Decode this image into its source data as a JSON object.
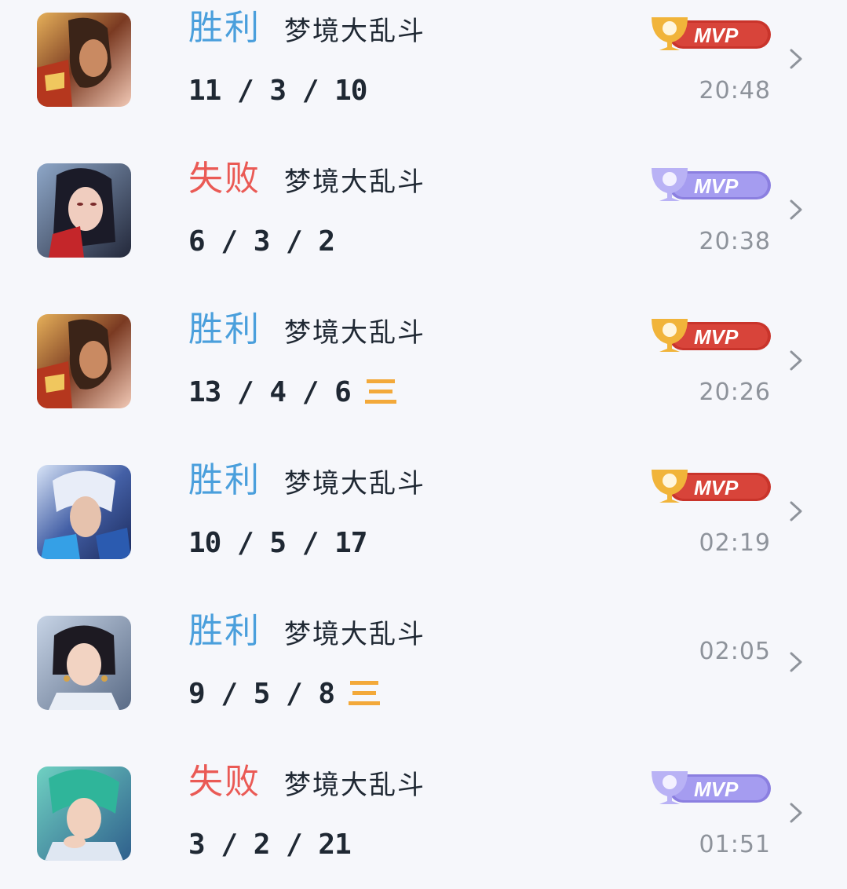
{
  "colors": {
    "win": "#4a9fdc",
    "loss": "#ea5a55",
    "mvp_gold": "#c9342b",
    "mvp_silver": "#8b7fe0",
    "triple_kill": "#f3a93a",
    "time": "#8e939b"
  },
  "matches": [
    {
      "result": "胜利",
      "outcome": "win",
      "mode": "梦境大乱斗",
      "kda": "11 / 3 / 10",
      "mvp": "gold",
      "mvp_label": "MVP",
      "multi_kill": false,
      "time": "20:48",
      "hero_icon": "hero-avatar-1"
    },
    {
      "result": "失败",
      "outcome": "loss",
      "mode": "梦境大乱斗",
      "kda": "6 / 3 / 2",
      "mvp": "silver",
      "mvp_label": "MVP",
      "multi_kill": false,
      "time": "20:38",
      "hero_icon": "hero-avatar-2"
    },
    {
      "result": "胜利",
      "outcome": "win",
      "mode": "梦境大乱斗",
      "kda": "13 / 4 / 6",
      "mvp": "gold",
      "mvp_label": "MVP",
      "multi_kill": true,
      "multi_kill_icon": "triple-kill-icon",
      "time": "20:26",
      "hero_icon": "hero-avatar-1"
    },
    {
      "result": "胜利",
      "outcome": "win",
      "mode": "梦境大乱斗",
      "kda": "10 / 5 / 17",
      "mvp": "gold",
      "mvp_label": "MVP",
      "multi_kill": false,
      "time": "02:19",
      "hero_icon": "hero-avatar-3"
    },
    {
      "result": "胜利",
      "outcome": "win",
      "mode": "梦境大乱斗",
      "kda": "9 / 5 / 8",
      "mvp": "none",
      "multi_kill": true,
      "multi_kill_icon": "triple-kill-icon",
      "time": "02:05",
      "hero_icon": "hero-avatar-4"
    },
    {
      "result": "失败",
      "outcome": "loss",
      "mode": "梦境大乱斗",
      "kda": "3 / 2 / 21",
      "mvp": "silver",
      "mvp_label": "MVP",
      "multi_kill": false,
      "time": "01:51",
      "hero_icon": "hero-avatar-5"
    }
  ]
}
